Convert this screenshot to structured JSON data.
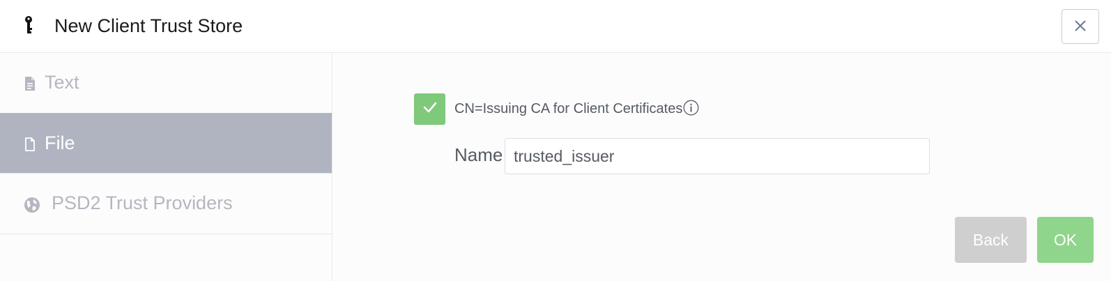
{
  "dialog": {
    "title": "New Client Trust Store",
    "icon": "key-icon",
    "close_icon": "close-icon"
  },
  "sidebar": {
    "items": [
      {
        "label": "Text",
        "icon": "document-text-icon",
        "active": false
      },
      {
        "label": "File",
        "icon": "file-icon",
        "active": true
      },
      {
        "label": "PSD2 Trust Providers",
        "icon": "globe-icon",
        "active": false
      }
    ]
  },
  "content": {
    "certificate": {
      "checked": true,
      "label": "CN=Issuing CA for Client Certificates",
      "info_icon": "info-icon"
    },
    "name_field": {
      "label": "Name",
      "value": "trusted_issuer"
    },
    "buttons": {
      "back": "Back",
      "ok": "OK"
    }
  },
  "colors": {
    "checkbox": "#7ec97a",
    "ok_button": "#8fd58b",
    "back_button": "#cfcfcf",
    "sidebar_active": "#b0b4c0",
    "sidebar_inactive_text": "#b4b7c0"
  }
}
